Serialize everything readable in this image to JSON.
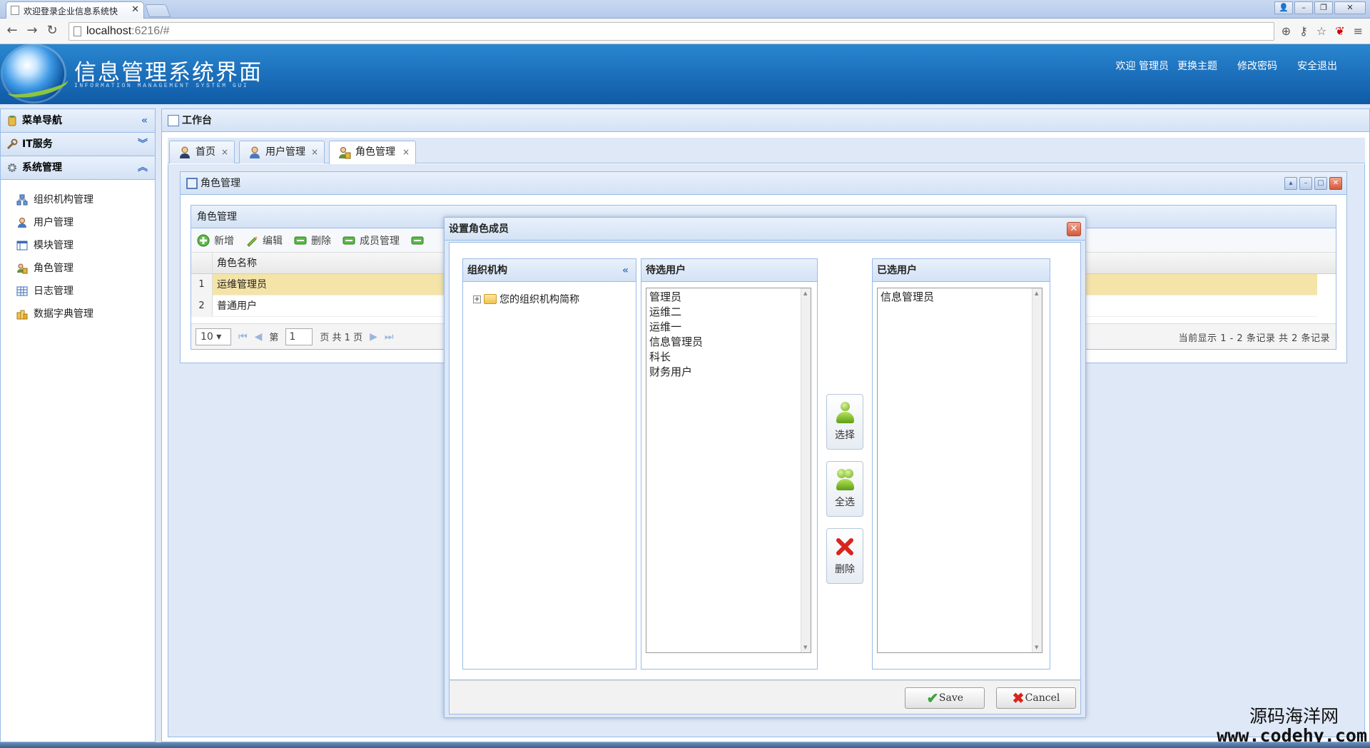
{
  "browser": {
    "tab_title": "欢迎登录企业信息系统快",
    "url_host": "localhost",
    "url_path": ":6216/#"
  },
  "header": {
    "title": "信息管理系统界面",
    "subtitle": "INFORMATION MANAGEMENT SYSTEM GUI",
    "links": {
      "welcome": "欢迎 管理员",
      "theme": "更换主题",
      "password": "修改密码",
      "logout": "安全退出"
    }
  },
  "sidebar": {
    "title": "菜单导航",
    "groups": [
      {
        "label": "IT服务"
      },
      {
        "label": "系统管理"
      }
    ],
    "items": [
      {
        "label": "组织机构管理",
        "icon": "org-icon"
      },
      {
        "label": "用户管理",
        "icon": "user-icon"
      },
      {
        "label": "模块管理",
        "icon": "module-icon"
      },
      {
        "label": "角色管理",
        "icon": "role-icon"
      },
      {
        "label": "日志管理",
        "icon": "log-icon"
      },
      {
        "label": "数据字典管理",
        "icon": "dictionary-icon"
      }
    ]
  },
  "workspace": {
    "title": "工作台",
    "tabs": [
      {
        "label": "首页"
      },
      {
        "label": "用户管理"
      },
      {
        "label": "角色管理"
      }
    ]
  },
  "role_panel": {
    "title": "角色管理",
    "grid_title": "角色管理",
    "toolbar": {
      "add": "新增",
      "edit": "编辑",
      "delete": "删除",
      "members": "成员管理"
    },
    "column": "角色名称",
    "rows": [
      {
        "num": "1",
        "name": "运维管理员"
      },
      {
        "num": "2",
        "name": "普通用户"
      }
    ],
    "pager": {
      "page_size": "10",
      "page_label": "第",
      "page_value": "1",
      "page_total": "页 共 1 页",
      "info": "当前显示 1 - 2 条记录 共 2 条记录"
    }
  },
  "dialog": {
    "title": "设置角色成员",
    "org_panel": {
      "title": "组织机构",
      "tree_root": "您的组织机构简称"
    },
    "candidates": {
      "title": "待选用户",
      "options": [
        "管理员",
        "运维二",
        "运维一",
        "信息管理员",
        "科长",
        "财务用户"
      ]
    },
    "selected": {
      "title": "已选用户",
      "options": [
        "信息管理员"
      ]
    },
    "buttons": {
      "select": "选择",
      "select_all": "全选",
      "remove": "删除",
      "save": "Save",
      "cancel": "Cancel"
    }
  },
  "watermark": {
    "line1": "源码海洋网",
    "line2": "www.codehy.com"
  }
}
